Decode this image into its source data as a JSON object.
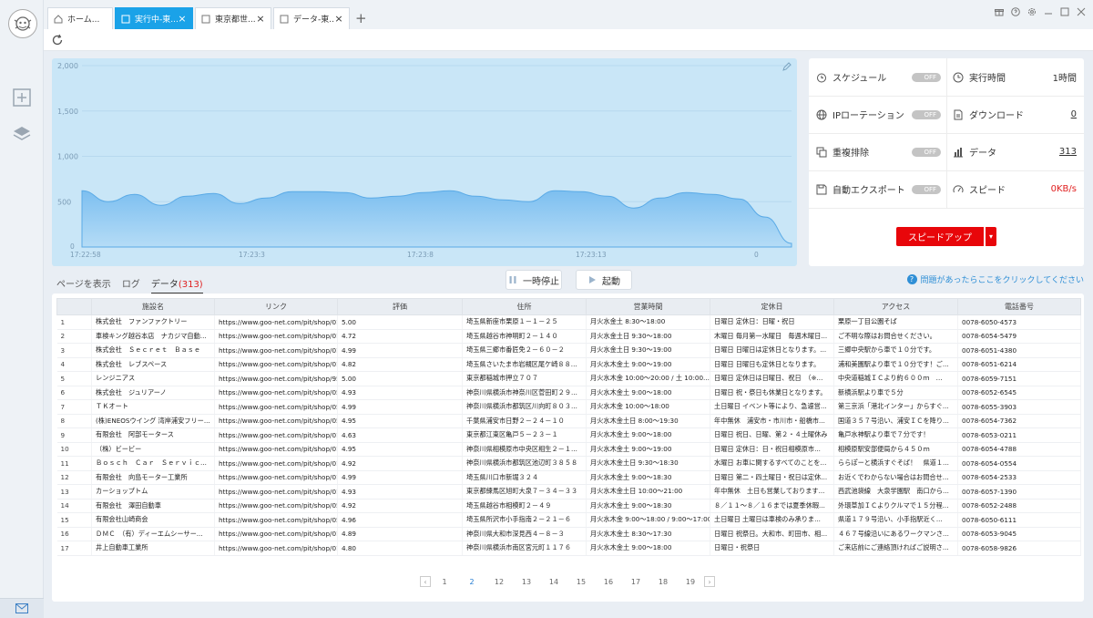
{
  "tabs": [
    {
      "label": "ホーム...",
      "icon": "home-icon"
    },
    {
      "label": "実行中-東...",
      "icon": "page-icon"
    },
    {
      "label": "東京都世...",
      "icon": "page-icon"
    },
    {
      "label": "データ-東...",
      "icon": "page-icon"
    }
  ],
  "chart_data": {
    "type": "area",
    "title": "",
    "xlabel": "",
    "ylabel": "",
    "ylim": [
      0,
      2000
    ],
    "yticks": [
      "2,000",
      "1,500",
      "1,000",
      "500",
      "0"
    ],
    "xtick_labels": [
      "17:22:58",
      "17:23:3",
      "17:23:8",
      "17:23:13",
      "0"
    ],
    "color": "#8cc8f0",
    "values": [
      620,
      500,
      580,
      460,
      560,
      590,
      480,
      540,
      610,
      610,
      600,
      540,
      560,
      600,
      620,
      560,
      520,
      500,
      620,
      610,
      560,
      430,
      540,
      600,
      580,
      530,
      330,
      40
    ],
    "grid": true
  },
  "stats": {
    "schedule": {
      "label": "スケジュール",
      "toggle": "OFF"
    },
    "runtime": {
      "label": "実行時間",
      "value": "1時間"
    },
    "ip_rotation": {
      "label": "IPローテーション",
      "toggle": "OFF"
    },
    "download": {
      "label": "ダウンロード",
      "value": "0"
    },
    "dedup": {
      "label": "重複排除",
      "toggle": "OFF"
    },
    "data": {
      "label": "データ",
      "value": "313"
    },
    "auto_export": {
      "label": "自動エクスポート",
      "toggle": "OFF"
    },
    "speed": {
      "label": "スピード",
      "value": "0KB/s"
    },
    "speed_up_label": "スピードアップ"
  },
  "subtabs": {
    "page_view": "ページを表示",
    "log": "ログ",
    "data_label": "データ",
    "data_count": "(313)"
  },
  "controls": {
    "pause": "一時停止",
    "start": "起動",
    "help": "問題があったらここをクリックしてください"
  },
  "table": {
    "headers": [
      "",
      "施設名",
      "リンク",
      "評価",
      "住所",
      "営業時間",
      "定休日",
      "アクセス",
      "電話番号"
    ],
    "rows": [
      [
        "1",
        "株式会社　ファンファクトリー",
        "https://www.goo-net.com/pit/shop/01...",
        "5.00",
        "埼玉県新座市栗原１－１－２５",
        "月火水金土 8:30～18:00",
        "日曜日 定休日：日曜・祝日",
        "栗原一丁目公園そば",
        "0078-6050-4573"
      ],
      [
        "2",
        "車検キング越谷本店　ナカジマ自動...",
        "https://www.goo-net.com/pit/shop/01...",
        "4.72",
        "埼玉県越谷市神明町２－１４０",
        "月火水金土日 9:30～18:00",
        "木曜日 毎月第一水曜日　毎週木曜日...",
        "ご不明な際はお問合せください。",
        "0078-6054-5479"
      ],
      [
        "3",
        "株式会社　Ｓｅｃｒｅｔ　Ｂａｓｅ",
        "https://www.goo-net.com/pit/shop/01...",
        "4.99",
        "埼玉県三郷市番匠免２－６０－２",
        "月火水金土日 9:30～19:00",
        "日曜日 日曜日は定休日となります。...",
        "三郷中央駅から車で１０分です。",
        "0078-6051-4380"
      ],
      [
        "4",
        "株式会社　レブスペース",
        "https://www.goo-net.com/pit/shop/01...",
        "4.82",
        "埼玉県さいたま市岩槻区尾ケ崎８８...",
        "月火水木金土 9:00～19:00",
        "日曜日 日曜日も定休日となります。",
        "浦和美園駅より車で１０分です！ご...",
        "0078-6051-6214"
      ],
      [
        "5",
        "レンジニアス",
        "https://www.goo-net.com/pit/shop/95...",
        "5.00",
        "東京都稲城市押立７０７",
        "月火水木金 10:00～20:00 / 土 10:00...",
        "日曜日 定休日は日曜日、祝日　（※...",
        "中央道稲城ＩＣより約６００ｍ　...",
        "0078-6059-7151"
      ],
      [
        "6",
        "株式会社　ジュリアーノ",
        "https://www.goo-net.com/pit/shop/05...",
        "4.93",
        "神奈川県横浜市神奈川区菅田町２９...",
        "月火水木金土 9:00～18:00",
        "日曜日 祝・祭日も休業日となります。",
        "新横浜駅より車で５分",
        "0078-6052-6545"
      ],
      [
        "7",
        "ＴＫオート",
        "https://www.goo-net.com/pit/shop/05...",
        "4.99",
        "神奈川県横浜市都筑区川向町８０３...",
        "月火水木金 10:00～18:00",
        "土日曜日 イベント等により、急遽営...",
        "第三京浜「港北インター」からすぐ...",
        "0078-6055-3903"
      ],
      [
        "8",
        "(株)ENEOSウイング 湾岸浦安フリー...",
        "https://www.goo-net.com/pit/shop/05...",
        "4.95",
        "千葉県浦安市日野２－２４－１０",
        "月火水木金土日 8:00～19:30",
        "年中無休　浦安市・市川市・船橋市...",
        "国道３５７号沿い、浦安ＩＣを降り...",
        "0078-6054-7362"
      ],
      [
        "9",
        "有限会社　阿部モータース",
        "https://www.goo-net.com/pit/shop/01...",
        "4.63",
        "東京都江東区亀戸５－２３－１",
        "月火水木金土 9:00～18:00",
        "日曜日 祝日、日曜、第２・４土曜休み",
        "亀戸水神駅より車で７分です！",
        "0078-6053-0211"
      ],
      [
        "10",
        "（株）ビービー",
        "https://www.goo-net.com/pit/shop/01...",
        "4.95",
        "神奈川県相模原市中央区相生２－１...",
        "月火水木金土 9:00～19:00",
        "日曜日 定休日：日・祝日相模原市...",
        "相模原駅安部便局から４５０ｍ",
        "0078-6054-4788"
      ],
      [
        "11",
        "Ｂｏｓｃｈ　Ｃａｒ　Ｓｅｒｖｉｃ...",
        "https://www.goo-net.com/pit/shop/01...",
        "4.92",
        "神奈川県横浜市都筑区池辺町３８５８",
        "月火水木金土日 9:30～18:30",
        "水曜日 お車に関するすべてのことを...",
        "ららぽーと横浜すぐそば！　県道１...",
        "0078-6054-0554"
      ],
      [
        "12",
        "有限会社　向島モーター工業所",
        "https://www.goo-net.com/pit/shop/01...",
        "4.99",
        "埼玉県川口市新堀３２４",
        "月火水木金土 9:00～18:30",
        "日曜日 第二・四土曜日・祝日は定休...",
        "お近くでわからない場合はお問合せ...",
        "0078-6054-2533"
      ],
      [
        "13",
        "カーショップトム",
        "https://www.goo-net.com/pit/shop/01...",
        "4.93",
        "東京都練馬区旭町大泉７－３４－３３",
        "月火水木金土日 10:00～21:00",
        "年中無休　土日も営業しております...",
        "西武池袋線　大泉学園駅　南口から...",
        "0078-6057-1390"
      ],
      [
        "14",
        "有限会社　澤田自動車",
        "https://www.goo-net.com/pit/shop/05...",
        "4.92",
        "埼玉県越谷市相模町２－４９",
        "月火水木金土 9:00～18:30",
        "８／１１～８／１６までは夏季休暇...",
        "外環草加ＩＣよりクルマで１５分程...",
        "0078-6052-2488"
      ],
      [
        "15",
        "有限会社山崎商会",
        "https://www.goo-net.com/pit/shop/05...",
        "4.96",
        "埼玉県所沢市小手指南２－２１－６",
        "月火水木金 9:00～18:00 / 9:00～17:00",
        "土日曜日 土曜日は車検のみ承りま...",
        "県道１７９号沿い、小手指駅近く...",
        "0078-6050-6111"
      ],
      [
        "16",
        "ＤＭＣ　（有）ディーエムシーサー...",
        "https://www.goo-net.com/pit/shop/01...",
        "4.89",
        "神奈川県大和市深見西４－８－３",
        "月火水木金土 8:30～17:30",
        "日曜日 祝祭日。大和市、町田市、相...",
        "４６７号線沿いにあるワークマンさ...",
        "0078-6053-9045"
      ],
      [
        "17",
        "井上自動車工業所",
        "https://www.goo-net.com/pit/shop/01...",
        "4.80",
        "神奈川県横浜市南区宮元町１１７６",
        "月火水木金土 9:00～18:00",
        "日曜日・祝祭日",
        "ご来店前にご連絡頂ければご説明さ...",
        "0078-6058-9826"
      ]
    ]
  },
  "pager": {
    "pages": [
      "1",
      "2",
      "12",
      "13",
      "14",
      "15",
      "16",
      "17",
      "18",
      "19"
    ],
    "current": "2"
  }
}
